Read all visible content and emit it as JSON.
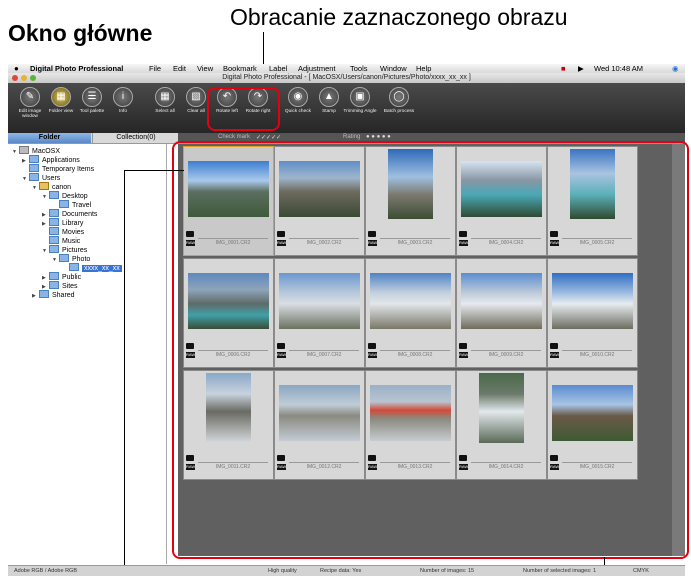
{
  "captions": {
    "main_window": "Okno główne",
    "rotate_selected": "Obracanie zaznaczonego obrazu"
  },
  "menubar": {
    "app_name": "Digital Photo Professional",
    "items": [
      "File",
      "Edit",
      "View",
      "Bookmark",
      "Label",
      "Adjustment",
      "Tools",
      "Window",
      "Help"
    ],
    "clock": "Wed 10:48 AM"
  },
  "window": {
    "title": "Digital Photo Professional - [ MacOSX/Users/canon/Pictures/Photo/xxxx_xx_xx ]"
  },
  "toolbar": {
    "buttons": [
      {
        "label": "Edit image window"
      },
      {
        "label": "Folder view"
      },
      {
        "label": "Tool palette"
      },
      {
        "label": "Info"
      },
      {
        "label": "Select all"
      },
      {
        "label": "Clear all"
      },
      {
        "label": "Rotate left"
      },
      {
        "label": "Rotate right"
      },
      {
        "label": "Quick check"
      },
      {
        "label": "Stamp"
      },
      {
        "label": "Trimming Angle"
      },
      {
        "label": "Batch process"
      }
    ]
  },
  "tabs": {
    "folder": "Folder",
    "collection": "Collection(0)"
  },
  "checkbar": {
    "check_mark": "Check mark",
    "rating": "Rating"
  },
  "tree": [
    "MacOSX",
    "Applications",
    "Temporary Items",
    "Users",
    "canon",
    "Desktop",
    "Travel",
    "Documents",
    "Library",
    "Movies",
    "Music",
    "Pictures",
    "Photo",
    "xxxx_xx_xx",
    "Public",
    "Sites",
    "Shared"
  ],
  "images": [
    {
      "name": "IMG_0001.CR2"
    },
    {
      "name": "IMG_0002.CR2"
    },
    {
      "name": "IMG_0003.CR2"
    },
    {
      "name": "IMG_0004.CR2"
    },
    {
      "name": "IMG_0005.CR2"
    },
    {
      "name": "IMG_0006.CR2"
    },
    {
      "name": "IMG_0007.CR2"
    },
    {
      "name": "IMG_0008.CR2"
    },
    {
      "name": "IMG_0009.CR2"
    },
    {
      "name": "IMG_0010.CR2"
    },
    {
      "name": "IMG_0011.CR2"
    },
    {
      "name": "IMG_0012.CR2"
    },
    {
      "name": "IMG_0013.CR2"
    },
    {
      "name": "IMG_0014.CR2"
    },
    {
      "name": "IMG_0015.CR2"
    }
  ],
  "status": {
    "color_space": "Adobe RGB / Adobe RGB",
    "quality": "High quality",
    "recipe": "Recipe data: Yes",
    "num_images": "Number of images: 15",
    "num_selected": "Number of selected images: 1",
    "cmyk": "CMYK"
  },
  "colors": {
    "highlight": "#e4000f",
    "selection": "#3874d8",
    "grid_bg": "#606060"
  }
}
